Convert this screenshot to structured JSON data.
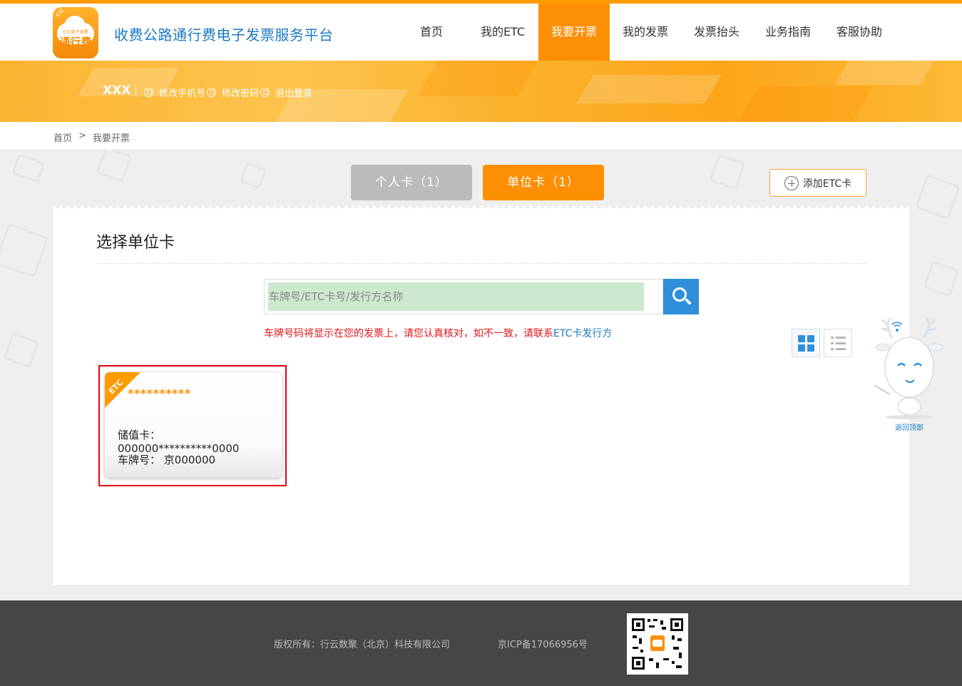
{
  "header": {
    "site_title": "收费公路通行费电子发票服务平台",
    "logo_text": "通行费",
    "logo_badge": "ETC",
    "logo_sub": "ETC电子发票",
    "nav": [
      {
        "label": "首页",
        "active": false
      },
      {
        "label": "我的ETC",
        "active": false
      },
      {
        "label": "我要开票",
        "active": true
      },
      {
        "label": "我的发票",
        "active": false
      },
      {
        "label": "发票抬头",
        "active": false
      },
      {
        "label": "业务指南",
        "active": false
      },
      {
        "label": "客服协助",
        "active": false
      }
    ]
  },
  "user": {
    "name": "XXX",
    "links": [
      "修改手机号",
      "修改密码",
      "退出登录"
    ]
  },
  "breadcrumb": {
    "home": "首页",
    "separator": ">",
    "current": "我要开票"
  },
  "tabs": {
    "personal": "个人卡（1）",
    "company": "单位卡（1）",
    "active": "company"
  },
  "add_button": "添加ETC卡",
  "panel": {
    "title": "选择单位卡",
    "search_placeholder": "车牌号/ETC卡号/发行方名称",
    "search_value": "",
    "notice_text": "车牌号码将显示在您的发票上，请您认真核对，如不一致，请联系",
    "notice_link": "ETC卡发行方",
    "view_mode": "grid"
  },
  "cards": [
    {
      "corner": "ETC",
      "masked_name": "**********",
      "card_label": "储值卡：",
      "card_number": "000000**********0000",
      "plate_label": "车牌号：",
      "plate": "京000000",
      "selected": true
    }
  ],
  "back_to_top": "返回顶部",
  "footer": {
    "copyright": "版权所有：行云数聚（北京）科技有限公司",
    "icp": "京ICP备17066956号"
  },
  "colors": {
    "accent_orange": "#fd8f05",
    "brand_blue": "#1a79c3",
    "notice_red": "#e2161b",
    "selection_red": "#e60012"
  }
}
